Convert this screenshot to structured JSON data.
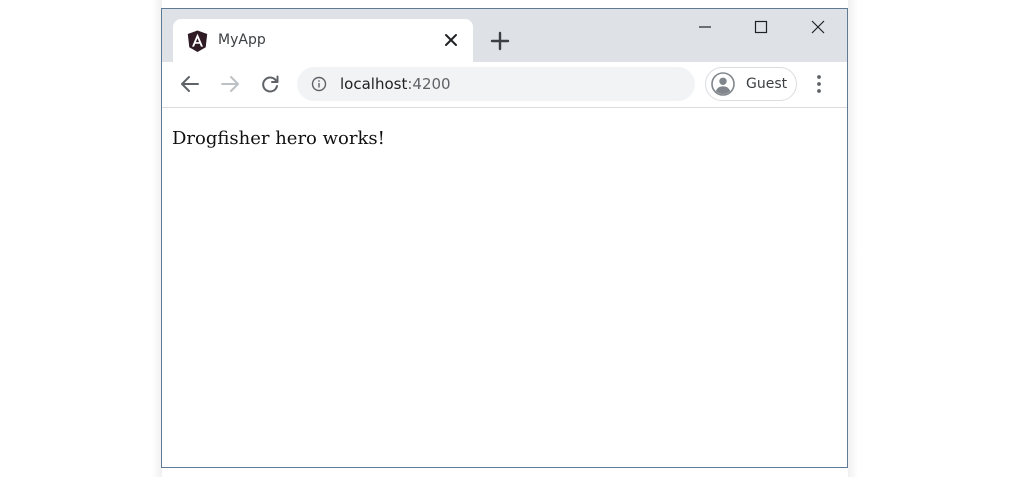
{
  "browser": {
    "tab": {
      "title": "MyApp",
      "favicon": "angular-logo-icon",
      "close_icon": "close-icon"
    },
    "new_tab_icon": "plus-icon",
    "window_controls": [
      "minimize-icon",
      "maximize-icon",
      "close-icon"
    ],
    "nav": {
      "back_icon": "arrow-left-icon",
      "forward_icon": "arrow-right-icon",
      "reload_icon": "reload-icon"
    },
    "omnibox": {
      "info_icon": "info-icon",
      "host": "localhost",
      "port": ":4200"
    },
    "profile": {
      "label": "Guest",
      "avatar_icon": "guest-avatar-icon"
    },
    "menu_icon": "kebab-menu-icon"
  },
  "page": {
    "body_text": "Drogfisher hero works!"
  },
  "colors": {
    "tabstrip": "#dee1e6",
    "omnibox": "#f1f3f4",
    "window_border": "#5f7a94",
    "angular_logo": "#2e1b24"
  }
}
